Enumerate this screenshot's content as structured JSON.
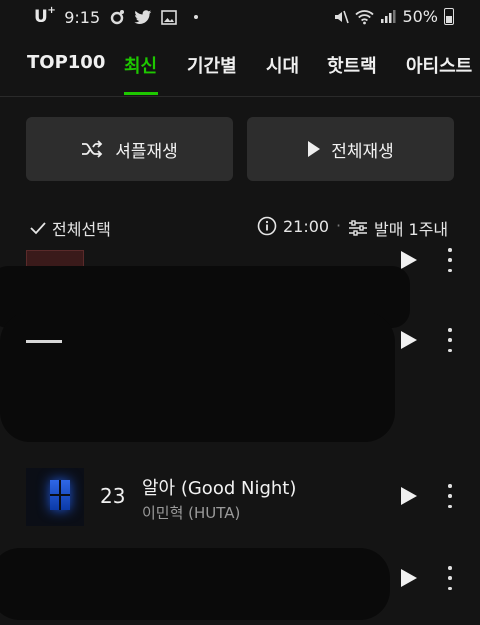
{
  "status_bar": {
    "carrier": "U",
    "carrier_mark": "+",
    "time": "9:15",
    "battery": "50%"
  },
  "tabs": [
    {
      "label": "TOP100",
      "active": false
    },
    {
      "label": "최신",
      "active": true
    },
    {
      "label": "기간별",
      "active": false
    },
    {
      "label": "시대",
      "active": false
    },
    {
      "label": "핫트랙",
      "active": false
    },
    {
      "label": "아티스트",
      "active": false
    }
  ],
  "actions": {
    "shuffle_label": "셔플재생",
    "play_all_label": "전체재생"
  },
  "list_controls": {
    "select_all_label": "전체선택",
    "time_text": "21:00",
    "separator": "·",
    "sort_label": "발매 1주내"
  },
  "songs": [
    {
      "rank": "23",
      "title": "알아 (Good Night)",
      "artist": "이민혁 (HUTA)"
    }
  ],
  "colors": {
    "accent": "#1ec800",
    "background": "#141414",
    "button_bg": "#2d2d2d",
    "artist_text": "#9a9a9a"
  }
}
